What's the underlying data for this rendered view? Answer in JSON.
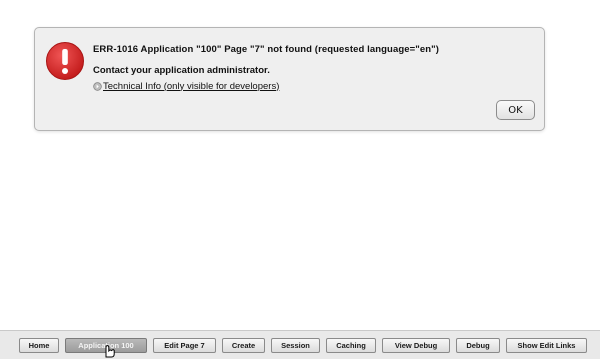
{
  "error": {
    "title": "ERR-1016 Application \"100\" Page \"7\" not found (requested language=\"en\")",
    "message": "Contact your application administrator.",
    "tech_info_label": "Technical Info (only visible for developers)",
    "ok_label": "OK",
    "icon": "error-circle-icon"
  },
  "toolbar": {
    "buttons": [
      {
        "label": "Home"
      },
      {
        "label": "Application 100",
        "active": true
      },
      {
        "label": "Edit Page 7"
      },
      {
        "label": "Create"
      },
      {
        "label": "Session"
      },
      {
        "label": "Caching"
      },
      {
        "label": "View Debug"
      },
      {
        "label": "Debug"
      },
      {
        "label": "Show Edit Links"
      }
    ]
  },
  "colors": {
    "error_red": "#d92b2b",
    "panel_bg": "#efefef",
    "toolbar_bg": "#e9e9e9",
    "active_button": "#a9a9a9"
  }
}
